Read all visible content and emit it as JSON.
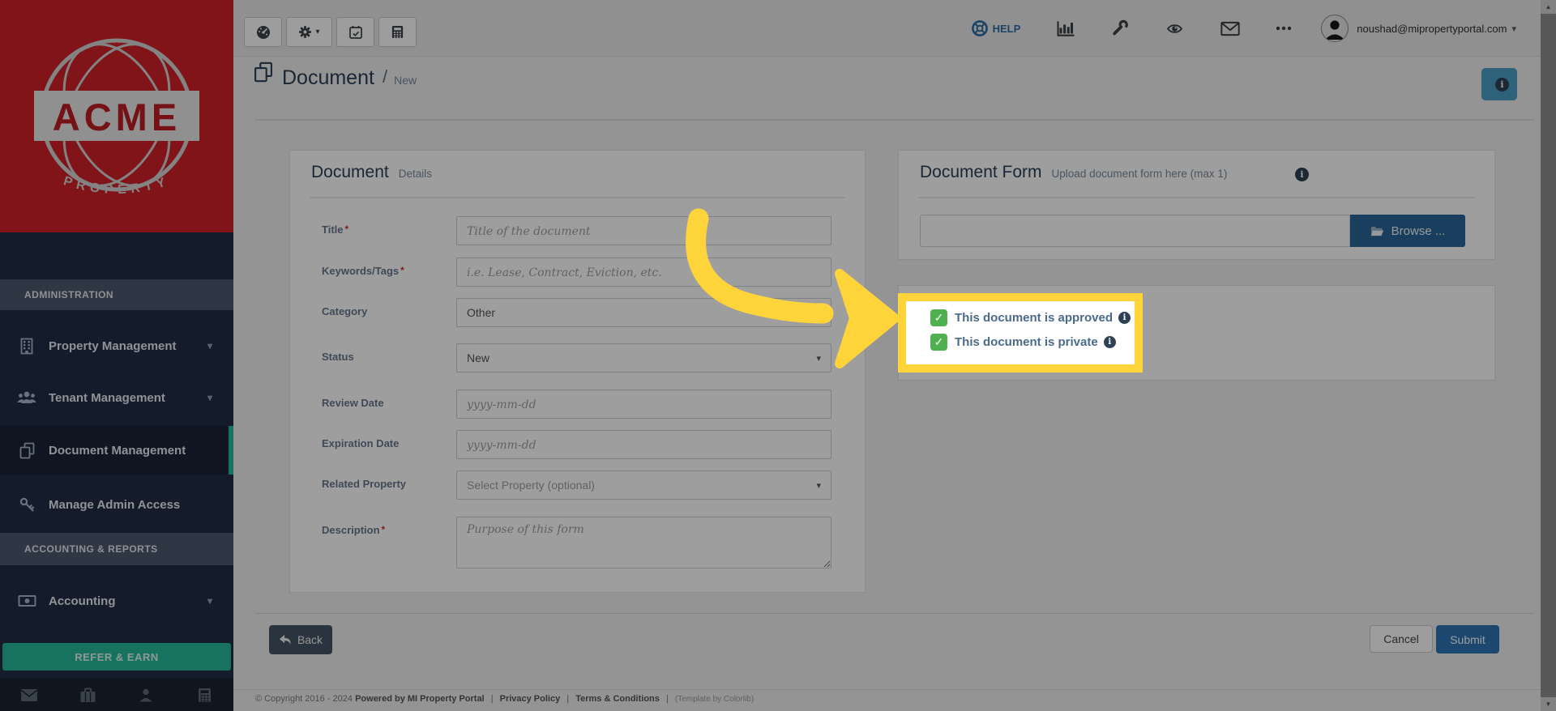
{
  "brand": {
    "name": "ACME",
    "tagline": "PROPERTY"
  },
  "topbar": {
    "toolbar_icons": [
      "gauge-icon",
      "gear-icon",
      "calendar-check-icon",
      "calculator-icon"
    ],
    "help_label": "HELP",
    "action_icons": [
      "bar-chart-icon",
      "wrench-icon",
      "eye-icon",
      "envelope-icon",
      "ellipsis-icon"
    ],
    "user_email": "noushad@mipropertyportal.com"
  },
  "breadcrumb": {
    "title": "Document",
    "separator": "/",
    "page": "New"
  },
  "sidebar": {
    "sections": [
      {
        "header": "ADMINISTRATION",
        "items": [
          {
            "label": "Property Management",
            "icon": "building-icon",
            "expandable": true,
            "active": false
          },
          {
            "label": "Tenant Management",
            "icon": "users-icon",
            "expandable": true,
            "active": false
          },
          {
            "label": "Document Management",
            "icon": "documents-icon",
            "expandable": false,
            "active": true
          },
          {
            "label": "Manage Admin Access",
            "icon": "key-icon",
            "expandable": false,
            "active": false
          }
        ]
      },
      {
        "header": "ACCOUNTING & REPORTS",
        "items": [
          {
            "label": "Accounting",
            "icon": "money-icon",
            "expandable": true,
            "active": false
          }
        ]
      }
    ],
    "refer_button": "REFER & EARN",
    "footer_icons": [
      "envelope-icon",
      "briefcase-icon",
      "user-icon",
      "calculator-icon"
    ]
  },
  "document_details": {
    "title": "Document",
    "subtitle": "Details",
    "fields": [
      {
        "label": "Title",
        "required_mark": "*",
        "control": "input",
        "placeholder": "Title of the document",
        "value": ""
      },
      {
        "label": "Keywords/Tags",
        "required_mark": "*",
        "control": "input",
        "placeholder": "i.e. Lease, Contract, Eviction, etc.",
        "value": ""
      },
      {
        "label": "Category",
        "required_mark": "",
        "control": "select",
        "value": "Other"
      },
      {
        "label": "Status",
        "required_mark": "",
        "control": "select",
        "value": "New"
      },
      {
        "label": "Review Date",
        "required_mark": "",
        "control": "input",
        "placeholder": "yyyy-mm-dd",
        "value": ""
      },
      {
        "label": "Expiration Date",
        "required_mark": "",
        "control": "input",
        "placeholder": "yyyy-mm-dd",
        "value": ""
      },
      {
        "label": "Related Property",
        "required_mark": "",
        "control": "select",
        "value": "Select Property (optional)"
      },
      {
        "label": "Description",
        "required_mark": "*",
        "control": "textarea",
        "placeholder": "Purpose of this form",
        "value": ""
      }
    ]
  },
  "document_form": {
    "title": "Document Form",
    "subtitle": "Upload document form here (max 1)",
    "file_value": "",
    "browse_label": "Browse ...",
    "checkboxes": [
      {
        "label": "This document is approved",
        "checked": true
      },
      {
        "label": "This document is private",
        "checked": true
      }
    ]
  },
  "actions": {
    "back": "Back",
    "cancel": "Cancel",
    "submit": "Submit"
  },
  "footer": {
    "copyright": "© Copyright 2016 - 2024",
    "powered_by": "Powered by MI Property Portal",
    "divider": "|",
    "privacy": "Privacy Policy",
    "terms": "Terms & Conditions",
    "template_credit": "(Template by Colorlib)"
  },
  "colors": {
    "highlight_yellow": "#FFD43B",
    "brand_red": "#CF2127",
    "sidebar_navy": "#212C44",
    "accent_green": "#26B99A",
    "checkbox_green": "#4EB04E",
    "submit_blue": "#2E75B5",
    "browse_blue": "#2A6496",
    "info_blue": "#4A9EC6",
    "heading_slate": "#2A3F54",
    "overlay": "rgba(0,0,0,0.38)"
  }
}
